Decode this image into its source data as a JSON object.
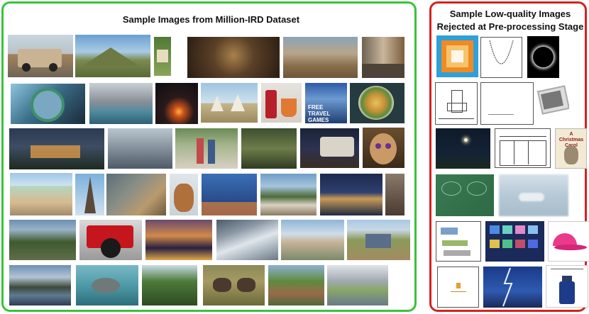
{
  "left_panel": {
    "title": "Sample Images from Million-IRD Dataset",
    "border_color": "#39c33b",
    "tile_labels": {
      "free_travel_games": "FREE TRAVEL GAMES"
    }
  },
  "right_panel": {
    "title_line1": "Sample Low-quality Images",
    "title_line2": "Rejected at Pre-processing Stage",
    "border_color": "#d4231d",
    "tile_labels": {
      "christmas_carol": "A Christmas Carol"
    }
  }
}
